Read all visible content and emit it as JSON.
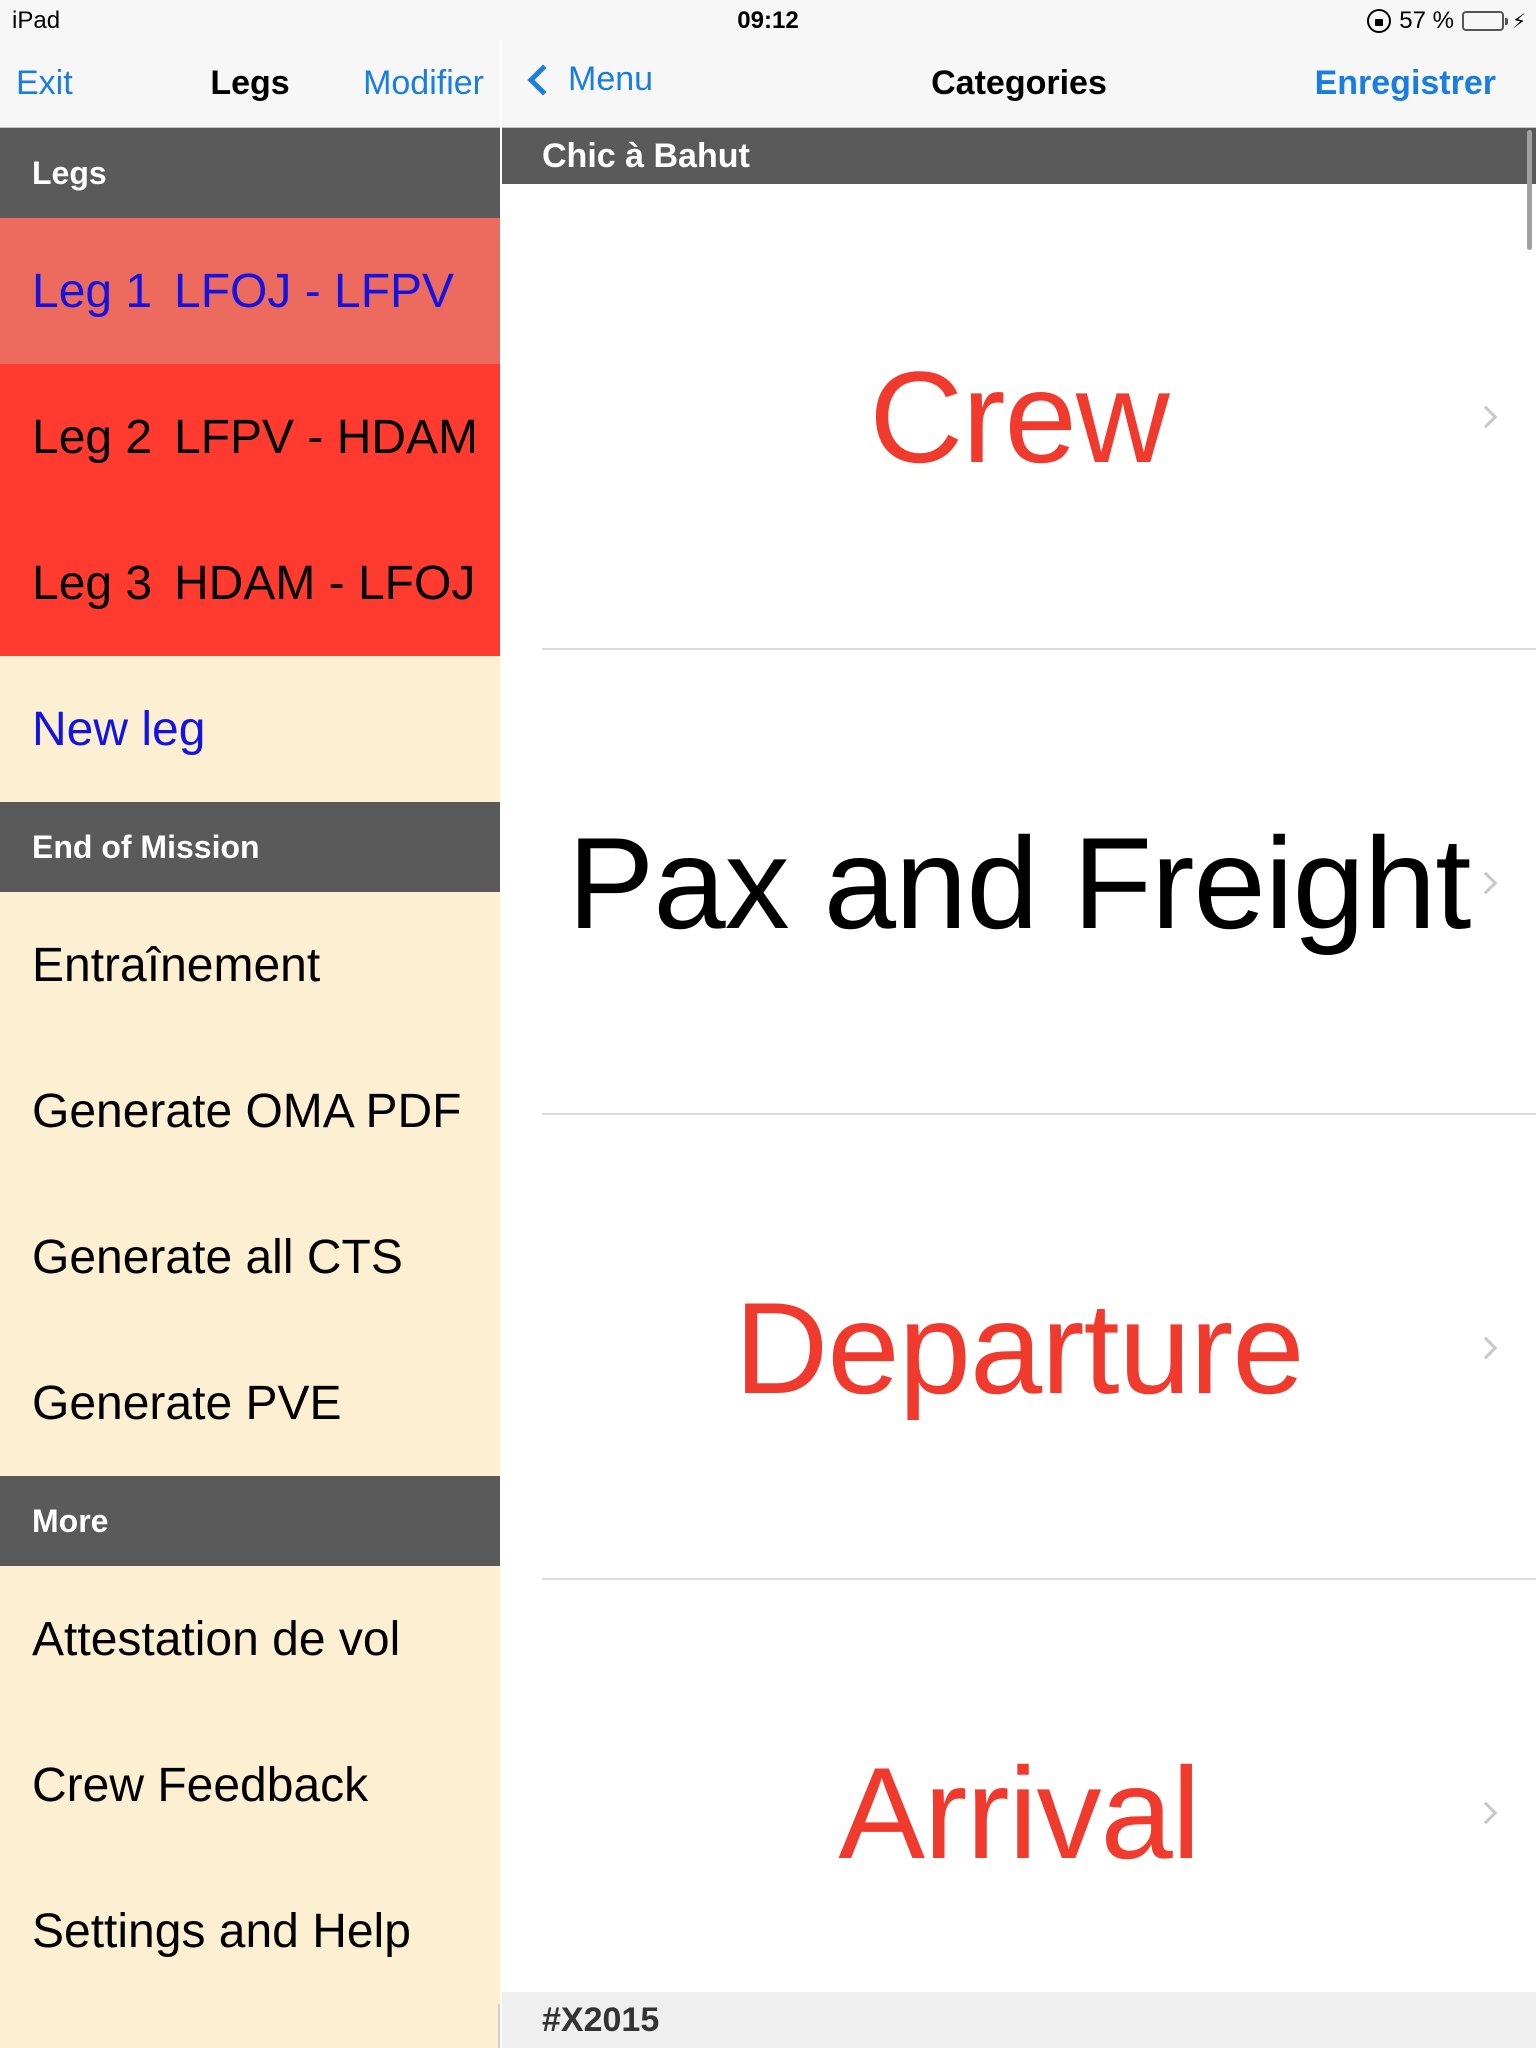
{
  "status_bar": {
    "device": "iPad",
    "time": "09:12",
    "battery": "57 %",
    "battery_level": 0.57
  },
  "left_nav": {
    "exit_label": "Exit",
    "title": "Legs",
    "edit_label": "Modifier"
  },
  "legs_section": {
    "header": "Legs",
    "legs": [
      {
        "number": "Leg 1",
        "route": "LFOJ - LFPV"
      },
      {
        "number": "Leg 2",
        "route": "LFPV - HDAM"
      },
      {
        "number": "Leg 3",
        "route": "HDAM - LFOJ"
      }
    ],
    "new_leg": "New leg"
  },
  "end_of_mission": {
    "header": "End of Mission",
    "items": [
      "Entraînement",
      "Generate OMA PDF",
      "Generate all CTS",
      "Generate PVE"
    ]
  },
  "more": {
    "header": "More",
    "items": [
      "Attestation de vol",
      "Crew Feedback",
      "Settings and Help"
    ]
  },
  "right_nav": {
    "back_label": "Menu",
    "title": "Categories",
    "save_label": "Enregistrer"
  },
  "mission_name": "Chic à Bahut",
  "categories": [
    {
      "label": "Crew"
    },
    {
      "label": "Pax and Freight"
    },
    {
      "label": "Departure"
    },
    {
      "label": "Arrival"
    }
  ],
  "footer": "#X2015",
  "colors": {
    "accent_blue": "#1a7de0",
    "leg_red": "#ff3b30",
    "leg_selected": "#ec6b5e",
    "category_red": "#f03a2e",
    "section_gray": "#5a5a5a",
    "sidebar_cream": "#fdf0d2"
  }
}
